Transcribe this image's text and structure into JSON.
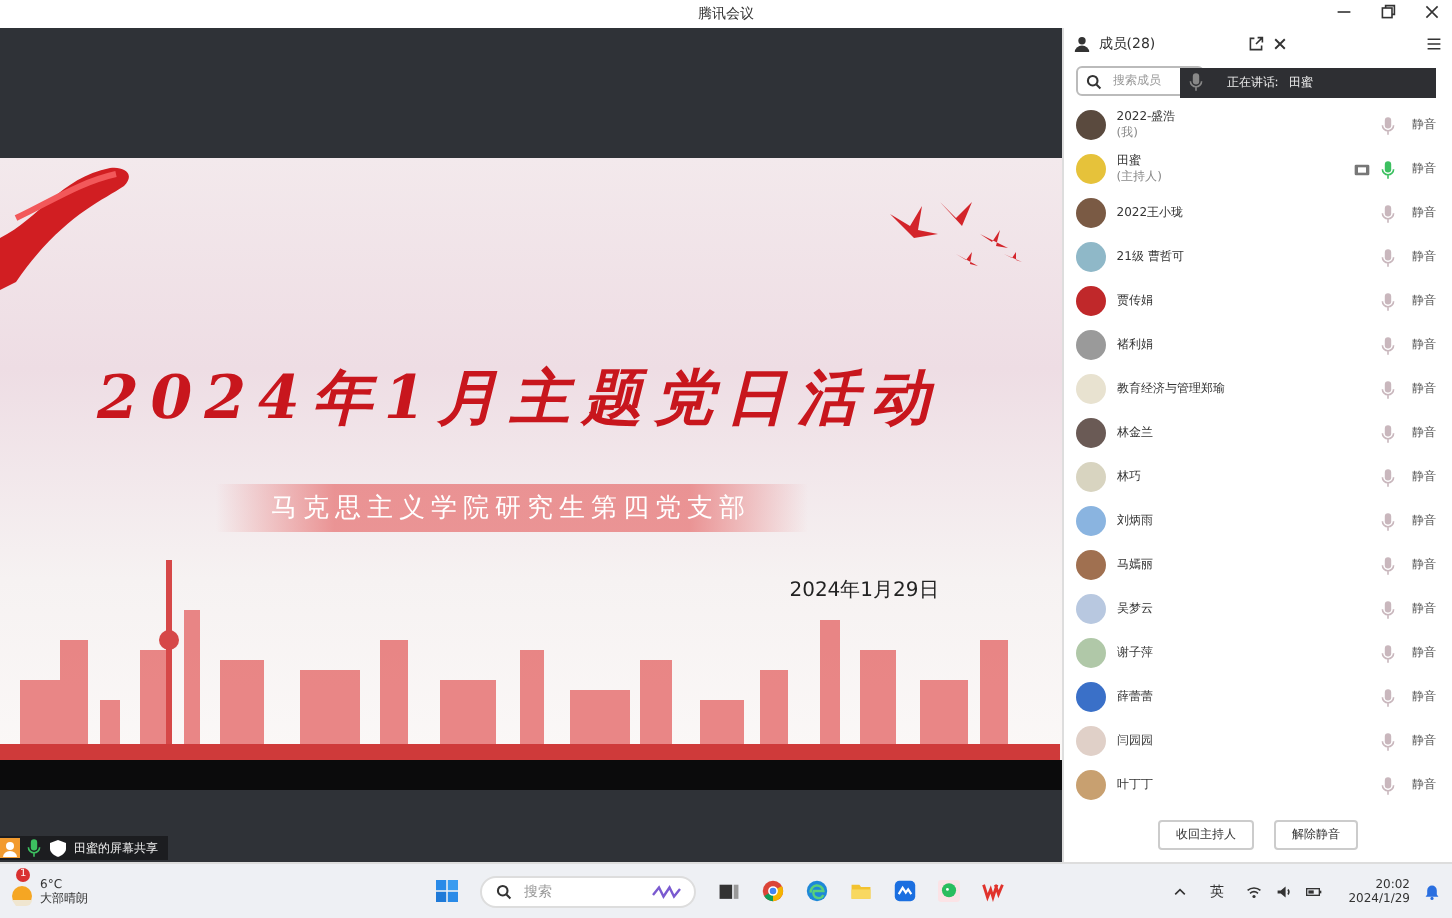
{
  "window": {
    "title": "腾讯会议"
  },
  "slide": {
    "title": "2024年1月主题党日活动",
    "subtitle": "马克思主义学院研究生第四党支部",
    "date": "2024年1月29日"
  },
  "share_bar": {
    "label": "田蜜的屏幕共享"
  },
  "members_panel": {
    "title": "成员(28)",
    "search": {
      "placeholder": "搜索成员"
    },
    "speaking_tooltip": {
      "label": "正在讲话:",
      "name": "田蜜"
    },
    "members": [
      {
        "name": "2022-盛浩",
        "role": "(我)",
        "muted": true,
        "video": false,
        "action": "静音"
      },
      {
        "name": "田蜜",
        "role": "(主持人)",
        "muted": false,
        "video": true,
        "action": "静音"
      },
      {
        "name": "2022王小珑",
        "muted": true,
        "video": false,
        "action": "静音"
      },
      {
        "name": "21级 曹哲可",
        "muted": true,
        "video": false,
        "action": "静音"
      },
      {
        "name": "贾传娟",
        "muted": true,
        "video": false,
        "action": "静音"
      },
      {
        "name": "褚利娟",
        "muted": true,
        "video": false,
        "action": "静音"
      },
      {
        "name": "教育经济与管理郑瑜",
        "muted": true,
        "video": false,
        "action": "静音"
      },
      {
        "name": "林金兰",
        "muted": true,
        "video": false,
        "action": "静音"
      },
      {
        "name": "林巧",
        "muted": true,
        "video": false,
        "action": "静音"
      },
      {
        "name": "刘炳雨",
        "muted": true,
        "video": false,
        "action": "静音"
      },
      {
        "name": "马嫣丽",
        "muted": true,
        "video": false,
        "action": "静音"
      },
      {
        "name": "吴梦云",
        "muted": true,
        "video": false,
        "action": "静音"
      },
      {
        "name": "谢子萍",
        "muted": true,
        "video": false,
        "action": "静音"
      },
      {
        "name": "薛蕾蕾",
        "muted": true,
        "video": false,
        "action": "静音"
      },
      {
        "name": "闫园园",
        "muted": true,
        "video": false,
        "action": "静音"
      },
      {
        "name": "叶丁丁",
        "muted": true,
        "video": false,
        "action": "静音"
      }
    ],
    "buttons": [
      "收回主持人",
      "解除静音"
    ]
  },
  "taskbar": {
    "weather": {
      "badge": "1",
      "temperature": "6°C",
      "condition": "大部晴朗"
    },
    "search": {
      "placeholder": "搜索"
    },
    "tray": {
      "language": "英",
      "time": "20:02",
      "date": "2024/1/29"
    }
  }
}
